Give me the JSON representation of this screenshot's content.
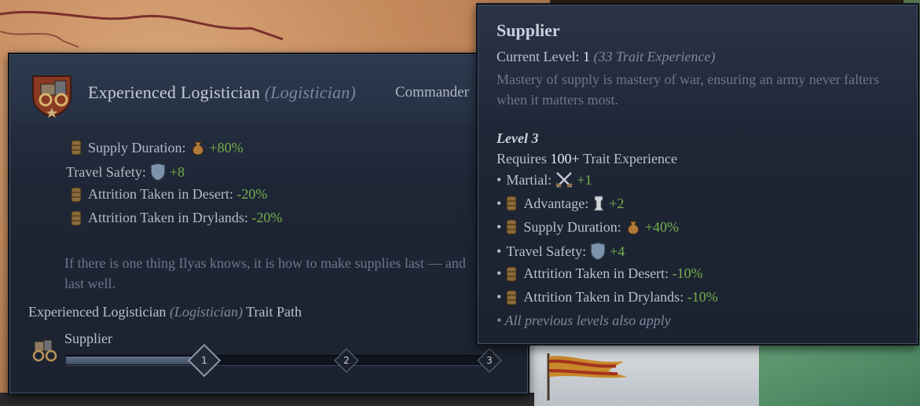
{
  "left_panel": {
    "title": "Experienced Logistician",
    "title_sub": "(Logistician)",
    "commander_label": "Commander",
    "modifiers": [
      {
        "label": "Supply Duration:",
        "value": "+80%",
        "icon": "supply-sack-icon",
        "has_bar_icon": true
      },
      {
        "label": "Travel Safety:",
        "value": "+8",
        "icon": "shield-icon",
        "has_bar_icon": false
      },
      {
        "label": "Attrition Taken in Desert:",
        "value": "-20%",
        "icon": "",
        "has_bar_icon": true
      },
      {
        "label": "Attrition Taken in Drylands:",
        "value": "-20%",
        "icon": "",
        "has_bar_icon": true
      }
    ],
    "flavor_text": "If there is one thing Ilyas knows, it is how to make supplies last — and last well.",
    "path_title_main": "Experienced Logistician",
    "path_title_sub": "(Logistician)",
    "path_title_suffix": "Trait Path",
    "path_level_name": "Supplier",
    "progress_fraction": 0.33,
    "nodes": [
      "1",
      "2",
      "3"
    ]
  },
  "tooltip": {
    "title": "Supplier",
    "current_level_label": "Current Level:",
    "current_level_value": "1",
    "current_xp": "(33 Trait Experience)",
    "description": "Mastery of supply is mastery of war, ensuring an army never falters when it matters most.",
    "level_heading": "Level 3",
    "requires_prefix": "Requires",
    "requires_value": "100+",
    "requires_suffix": "Trait Experience",
    "bonuses": [
      {
        "label": "Martial:",
        "value": "+1",
        "icon": "crossed-swords-icon",
        "has_bar_icon": false
      },
      {
        "label": "Advantage:",
        "value": "+2",
        "icon": "chess-rook-icon",
        "has_bar_icon": true
      },
      {
        "label": "Supply Duration:",
        "value": "+40%",
        "icon": "supply-sack-icon",
        "has_bar_icon": true
      },
      {
        "label": "Travel Safety:",
        "value": "+4",
        "icon": "shield-icon",
        "has_bar_icon": false
      },
      {
        "label": "Attrition Taken in Desert:",
        "value": "-10%",
        "icon": "",
        "has_bar_icon": true
      },
      {
        "label": "Attrition Taken in Drylands:",
        "value": "-10%",
        "icon": "",
        "has_bar_icon": true
      }
    ],
    "footer_note": "• All previous levels also apply"
  }
}
